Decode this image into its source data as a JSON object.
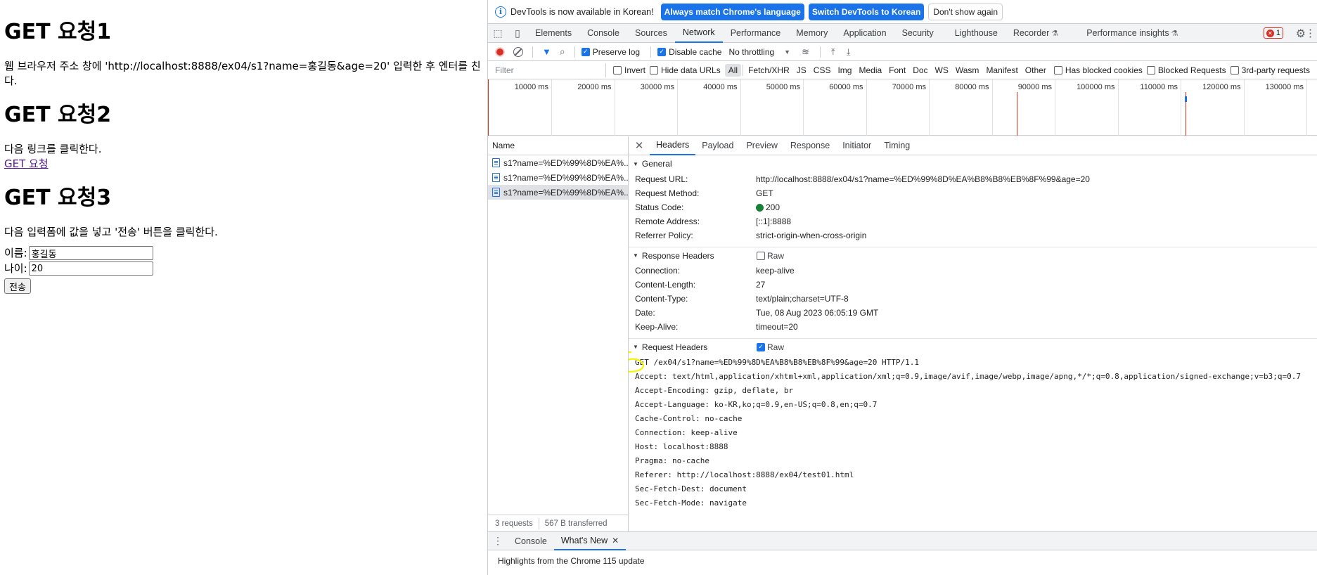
{
  "page": {
    "h1_1": "GET 요청1",
    "p1": "웹 브라우저 주소 창에 'http://localhost:8888/ex04/s1?name=홍길동&age=20' 입력한 후 엔터를 친다.",
    "h1_2": "GET 요청2",
    "p2": "다음 링크를 클릭한다.",
    "link": "GET 요청",
    "h1_3": "GET 요청3",
    "p3": "다음 입력폼에 값을 넣고 '전송' 버튼을 클릭한다.",
    "name_label": "이름:",
    "name_value": "홍길동",
    "age_label": "나이:",
    "age_value": "20",
    "submit_label": "전송"
  },
  "infobar": {
    "message": "DevTools is now available in Korean!",
    "match_button": "Always match Chrome's language",
    "switch_button": "Switch DevTools to Korean",
    "dismiss_button": "Don't show again"
  },
  "main_tabs": [
    "Elements",
    "Console",
    "Sources",
    "Network",
    "Performance",
    "Memory",
    "Application",
    "Security",
    "Lighthouse",
    "Recorder",
    "Performance insights"
  ],
  "active_tab": "Network",
  "error_count": "1",
  "toolbar": {
    "preserve_log": "Preserve log",
    "disable_cache": "Disable cache",
    "throttling": "No throttling"
  },
  "filterbar": {
    "placeholder": "Filter",
    "invert": "Invert",
    "hide_data_urls": "Hide data URLs",
    "types": [
      "All",
      "Fetch/XHR",
      "JS",
      "CSS",
      "Img",
      "Media",
      "Font",
      "Doc",
      "WS",
      "Wasm",
      "Manifest",
      "Other"
    ],
    "has_blocked_cookies": "Has blocked cookies",
    "blocked_requests": "Blocked Requests",
    "third_party": "3rd-party requests"
  },
  "timeline_labels": [
    "10000 ms",
    "20000 ms",
    "30000 ms",
    "40000 ms",
    "50000 ms",
    "60000 ms",
    "70000 ms",
    "80000 ms",
    "90000 ms",
    "100000 ms",
    "110000 ms",
    "120000 ms",
    "130000 ms"
  ],
  "requests": {
    "header": "Name",
    "rows": [
      "s1?name=%ED%99%8D%EA%...",
      "s1?name=%ED%99%8D%EA%...",
      "s1?name=%ED%99%8D%EA%..."
    ],
    "footer_count": "3 requests",
    "footer_transferred": "567 B transferred"
  },
  "detail_tabs": [
    "Headers",
    "Payload",
    "Preview",
    "Response",
    "Initiator",
    "Timing"
  ],
  "general": {
    "title": "General",
    "rows": [
      {
        "k": "Request URL:",
        "v": "http://localhost:8888/ex04/s1?name=%ED%99%8D%EA%B8%B8%EB%8F%99&age=20"
      },
      {
        "k": "Request Method:",
        "v": "GET"
      },
      {
        "k": "Status Code:",
        "v": "200"
      },
      {
        "k": "Remote Address:",
        "v": "[::1]:8888"
      },
      {
        "k": "Referrer Policy:",
        "v": "strict-origin-when-cross-origin"
      }
    ]
  },
  "response_headers": {
    "title": "Response Headers",
    "raw": "Raw",
    "rows": [
      {
        "k": "Connection:",
        "v": "keep-alive"
      },
      {
        "k": "Content-Length:",
        "v": "27"
      },
      {
        "k": "Content-Type:",
        "v": "text/plain;charset=UTF-8"
      },
      {
        "k": "Date:",
        "v": "Tue, 08 Aug 2023 06:05:19 GMT"
      },
      {
        "k": "Keep-Alive:",
        "v": "timeout=20"
      }
    ]
  },
  "request_headers": {
    "title": "Request Headers",
    "raw": "Raw",
    "lines": [
      "GET /ex04/s1?name=%ED%99%8D%EA%B8%B8%EB%8F%99&age=20 HTTP/1.1",
      "Accept: text/html,application/xhtml+xml,application/xml;q=0.9,image/avif,image/webp,image/apng,*/*;q=0.8,application/signed-exchange;v=b3;q=0.7",
      "Accept-Encoding: gzip, deflate, br",
      "Accept-Language: ko-KR,ko;q=0.9,en-US;q=0.8,en;q=0.7",
      "Cache-Control: no-cache",
      "Connection: keep-alive",
      "Host: localhost:8888",
      "Pragma: no-cache",
      "Referer: http://localhost:8888/ex04/test01.html",
      "Sec-Fetch-Dest: document",
      "Sec-Fetch-Mode: navigate"
    ]
  },
  "drawer": {
    "tabs": [
      "Console",
      "What's New"
    ],
    "body": "Highlights from the Chrome 115 update"
  },
  "colors": {
    "accent": "#1a73e8",
    "error": "#d93025",
    "ok": "#188038",
    "highlight": "#f5f500"
  }
}
